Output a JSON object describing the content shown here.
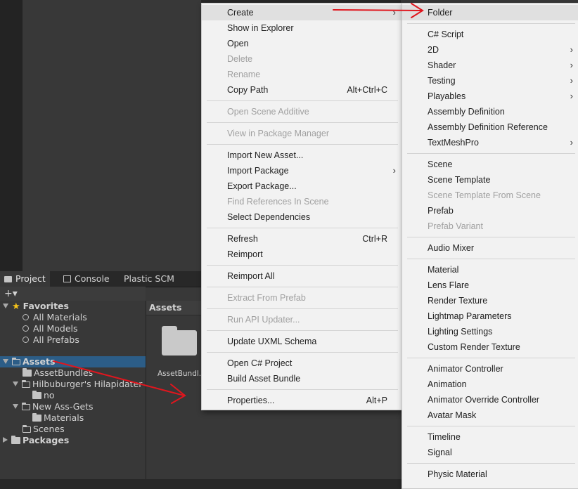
{
  "project_window": {
    "tabs": [
      {
        "label": "Project",
        "icon": "folder-icon"
      },
      {
        "label": "Console",
        "icon": "console-icon"
      },
      {
        "label": "Plastic SCM"
      }
    ],
    "toolbar": {
      "add_label": "+▾"
    },
    "tree": {
      "favorites": {
        "label": "Favorites",
        "items": [
          "All Materials",
          "All Models",
          "All Prefabs"
        ]
      },
      "assets": {
        "label": "Assets"
      },
      "asset_bundles": "AssetBundles",
      "hilbu": "Hilbuburger's Hilapidater",
      "no": "no",
      "new_ass": "New Ass-Gets",
      "materials": "Materials",
      "scenes": "Scenes",
      "packages": "Packages"
    },
    "assets_panel": {
      "header": "Assets",
      "item_label": "AssetBundl..."
    }
  },
  "context_menu": {
    "create": "Create",
    "show_in_explorer": "Show in Explorer",
    "open": "Open",
    "delete": "Delete",
    "rename": "Rename",
    "copy_path": "Copy Path",
    "copy_path_shortcut": "Alt+Ctrl+C",
    "open_scene_additive": "Open Scene Additive",
    "view_in_package_manager": "View in Package Manager",
    "import_new_asset": "Import New Asset...",
    "import_package": "Import Package",
    "export_package": "Export Package...",
    "find_references": "Find References In Scene",
    "select_dependencies": "Select Dependencies",
    "refresh": "Refresh",
    "refresh_shortcut": "Ctrl+R",
    "reimport": "Reimport",
    "reimport_all": "Reimport All",
    "extract_from_prefab": "Extract From Prefab",
    "run_api_updater": "Run API Updater...",
    "update_uxml_schema": "Update UXML Schema",
    "open_csharp_project": "Open C# Project",
    "build_asset_bundle": "Build Asset Bundle",
    "properties": "Properties...",
    "properties_shortcut": "Alt+P"
  },
  "create_submenu": {
    "folder": "Folder",
    "csharp_script": "C# Script",
    "two_d": "2D",
    "shader": "Shader",
    "testing": "Testing",
    "playables": "Playables",
    "assembly_definition": "Assembly Definition",
    "assembly_definition_reference": "Assembly Definition Reference",
    "textmeshpro": "TextMeshPro",
    "scene": "Scene",
    "scene_template": "Scene Template",
    "scene_template_from_scene": "Scene Template From Scene",
    "prefab": "Prefab",
    "prefab_variant": "Prefab Variant",
    "audio_mixer": "Audio Mixer",
    "material": "Material",
    "lens_flare": "Lens Flare",
    "render_texture": "Render Texture",
    "lightmap_parameters": "Lightmap Parameters",
    "lighting_settings": "Lighting Settings",
    "custom_render_texture": "Custom Render Texture",
    "animator_controller": "Animator Controller",
    "animation": "Animation",
    "animator_override_controller": "Animator Override Controller",
    "avatar_mask": "Avatar Mask",
    "timeline": "Timeline",
    "signal": "Signal",
    "physic_material": "Physic Material"
  },
  "colors": {
    "menu_bg": "#f2f2f2",
    "selection": "#2c5d87",
    "annotation_arrow": "#e0161e",
    "favorites_star": "#f4c21a"
  }
}
